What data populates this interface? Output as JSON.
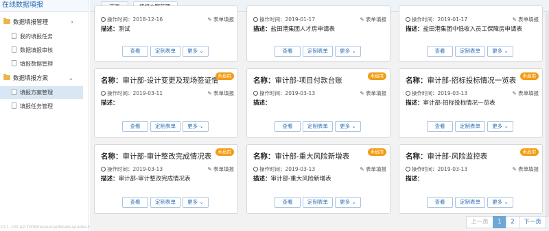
{
  "app": {
    "title": "在线数据填报"
  },
  "sidebar": {
    "groups": [
      {
        "label": "数据填报管理",
        "items": [
          {
            "label": "我的填报任务"
          },
          {
            "label": "数据填报审核"
          },
          {
            "label": "填报数据管理"
          }
        ]
      },
      {
        "label": "数据填报方案",
        "items": [
          {
            "label": "填报方案管理"
          },
          {
            "label": "填报任务管理"
          }
        ]
      }
    ],
    "status_url": "10.1.100.42:7008/resource/databus/index.html?roleId=bg_manager#tabIn..."
  },
  "tabs": [
    {
      "label": "首页"
    },
    {
      "label": "填报方案管理"
    }
  ],
  "labels": {
    "name": "名称：",
    "desc": "描述：",
    "op_time": "操作时间：",
    "form_fill": "表单填报",
    "view": "查看",
    "custom_form": "定制表单",
    "more": "更多",
    "disabled": "未启用"
  },
  "cards": [
    {
      "name": "",
      "date": "2018-12-16",
      "desc": "测试"
    },
    {
      "name": "",
      "date": "2019-01-17",
      "desc": "盐田港集团人才房申请表"
    },
    {
      "name": "",
      "date": "2019-01-17",
      "desc": "盐田港集团中低收入员工保障房申请表"
    },
    {
      "name": "审计部-设计变更及现场签证情况表",
      "date": "2019-03-11",
      "desc": ""
    },
    {
      "name": "审计部-项目付款台账",
      "date": "2019-03-13",
      "desc": ""
    },
    {
      "name": "审计部-招标投标情况一览表",
      "date": "2019-03-13",
      "desc": "审计部-招标投标情况一览表"
    },
    {
      "name": "审计部-审计整改完成情况表",
      "date": "2019-03-13",
      "desc": "审计部-审计整改完成情况表"
    },
    {
      "name": "审计部-重大风险新增表",
      "date": "2019-03-13",
      "desc": "审计部-重大风险新增表"
    },
    {
      "name": "审计部-风险监控表",
      "date": "2019-03-13",
      "desc": ""
    }
  ],
  "pagination": {
    "prev": "上一页",
    "pages": [
      "1",
      "2"
    ],
    "current": "1",
    "next": "下一页"
  }
}
